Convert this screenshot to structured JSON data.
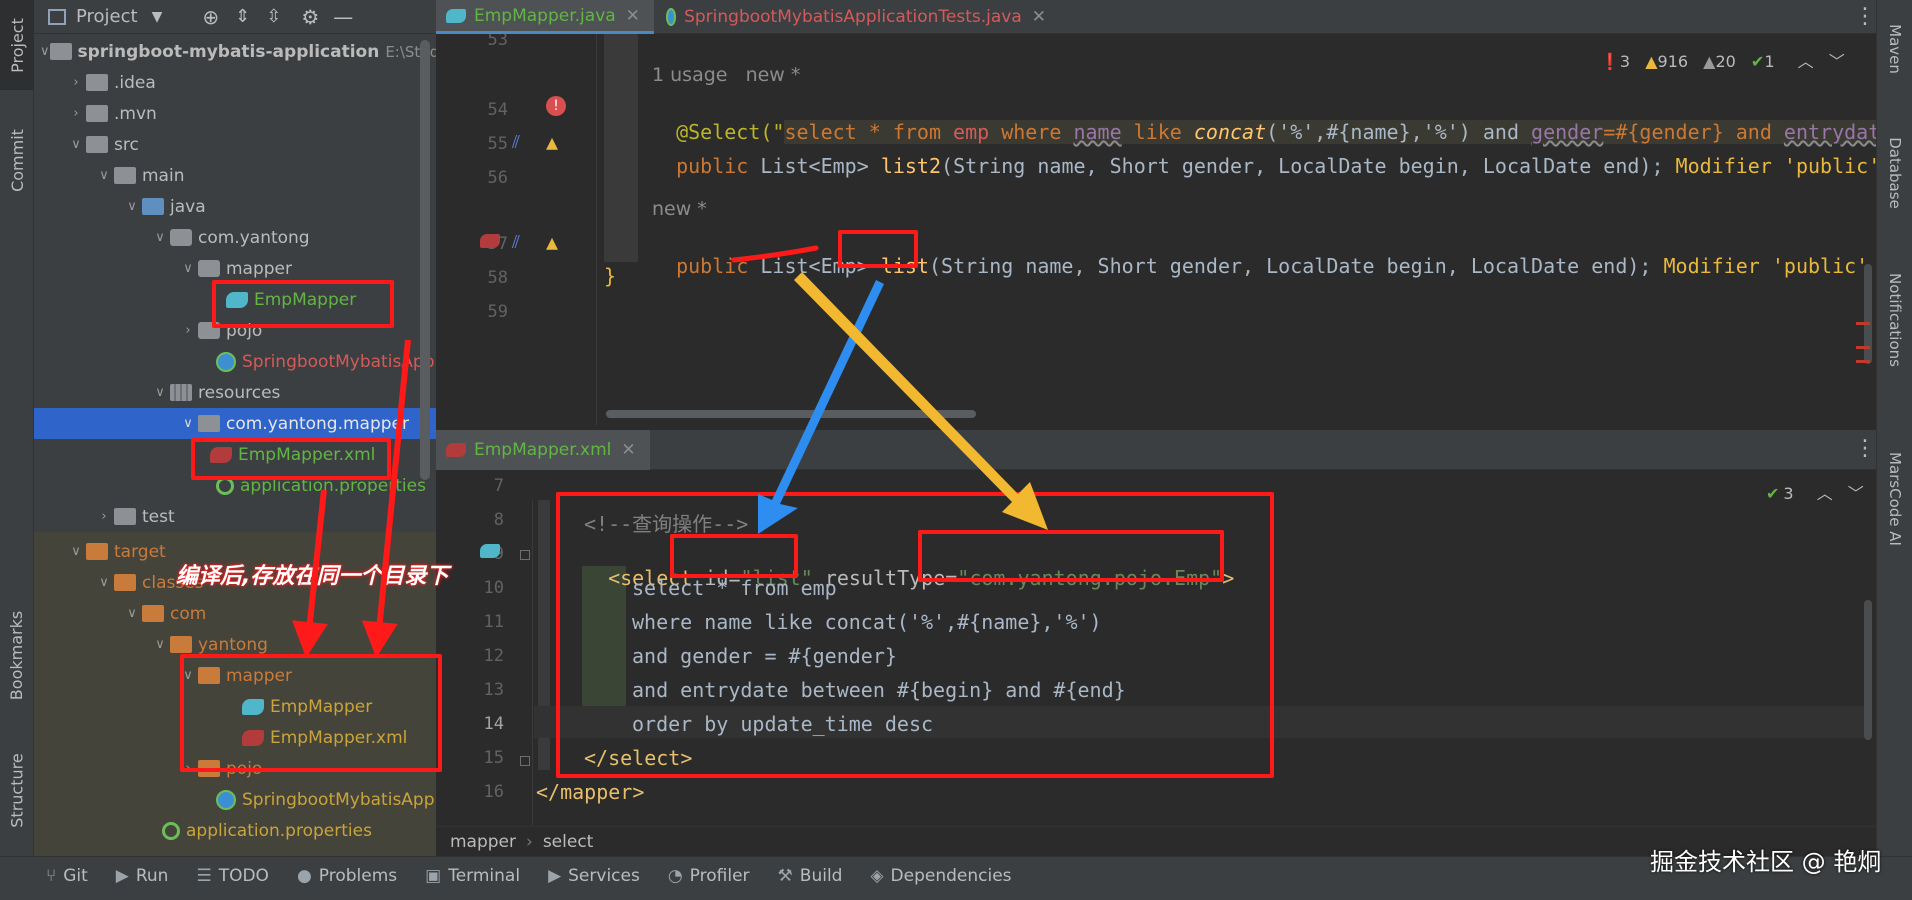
{
  "left_stripe": {
    "project": "Project",
    "commit": "Commit",
    "bookmarks": "Bookmarks",
    "structure": "Structure"
  },
  "project_panel": {
    "title": "Project",
    "tree": [
      {
        "label": "springboot-mybatis-application",
        "suffix": "E:\\Stud"
      },
      {
        "label": ".idea"
      },
      {
        "label": ".mvn"
      },
      {
        "label": "src"
      },
      {
        "label": "main"
      },
      {
        "label": "java"
      },
      {
        "label": "com.yantong"
      },
      {
        "label": "mapper"
      },
      {
        "label": "EmpMapper"
      },
      {
        "label": "pojo"
      },
      {
        "label": "SpringbootMybatisApp"
      },
      {
        "label": "resources"
      },
      {
        "label": "com.yantong.mapper"
      },
      {
        "label": "EmpMapper.xml"
      },
      {
        "label": "application.properties"
      },
      {
        "label": "test"
      },
      {
        "label": "target"
      },
      {
        "label": "classes"
      },
      {
        "label": "com"
      },
      {
        "label": "yantong"
      },
      {
        "label": "mapper"
      },
      {
        "label": "EmpMapper"
      },
      {
        "label": "EmpMapper.xml"
      },
      {
        "label": "pojo"
      },
      {
        "label": "SpringbootMybatisApp"
      },
      {
        "label": "application.properties"
      }
    ]
  },
  "editor_tabs": [
    {
      "label": "EmpMapper.java"
    },
    {
      "label": "SpringbootMybatisApplicationTests.java"
    }
  ],
  "editor1": {
    "inspections": {
      "errors": "3",
      "warnings": "916",
      "weak": "20",
      "ok": "1"
    },
    "line_numbers": [
      "53",
      "54",
      "55",
      "56",
      "57",
      "58",
      "59"
    ],
    "usage_hint": "1 usage   new *",
    "new_hint": "new *",
    "line54": {
      "prefix": "@Select(\"",
      "sql1": "select * from ",
      "emp": "emp",
      "sql2": " where ",
      "name": "name",
      "sql3": " like ",
      "concat": "concat",
      "sql4": "('%',#{name},'%') and ",
      "gender": "gender",
      "sql5": "=#{gender} and ",
      "entrydate": "entrydate"
    },
    "line55": {
      "kw": "public ",
      "type": "List<Emp> ",
      "method": "list2",
      "params": "(String name, Short gender, LocalDate begin, LocalDate end);",
      "warn": " Modifier 'public' i"
    },
    "line57": {
      "kw": "public ",
      "type": "List<Emp> ",
      "method": "list",
      "params": "(String name, Short gender, LocalDate begin, LocalDate end);",
      "warn": " Modifier 'public' is"
    },
    "line58": "}"
  },
  "editor2": {
    "tab": "EmpMapper.xml",
    "ok_count": "3",
    "line_numbers": [
      "7",
      "8",
      "9",
      "10",
      "11",
      "12",
      "13",
      "14",
      "15",
      "16"
    ],
    "comment": "<!--查询操作-->",
    "select_open": "<select ",
    "id_attr": "id=",
    "id_val": "\"list\"",
    "rt_attr": " resultType=",
    "rt_val": "\"com.yantong.pojo.Emp\"",
    "close_bracket": ">",
    "sql": [
      "select * from emp",
      "where name like concat('%',#{name},'%')",
      "and gender = #{gender}",
      "and entrydate between #{begin} and #{end}",
      "order by update_time desc"
    ],
    "select_close": "</select>",
    "mapper_close": "</mapper>"
  },
  "breadcrumb": {
    "a": "mapper",
    "b": "select"
  },
  "right_stripe": {
    "maven": "Maven",
    "database": "Database",
    "notifications": "Notifications",
    "marscode": "MarsCode AI"
  },
  "bottom_tools": [
    "Git",
    "Run",
    "TODO",
    "Problems",
    "Terminal",
    "Services",
    "Profiler",
    "Build",
    "Dependencies"
  ],
  "annotation": "编译后,存放在同一个目录下",
  "watermark": "掘金技术社区 @ 艳炯",
  "colors": {
    "red": "#ff1a1a",
    "blue_arrow": "#2e8df0",
    "yellow_arrow": "#f2b830",
    "selection": "#2f65ca"
  }
}
